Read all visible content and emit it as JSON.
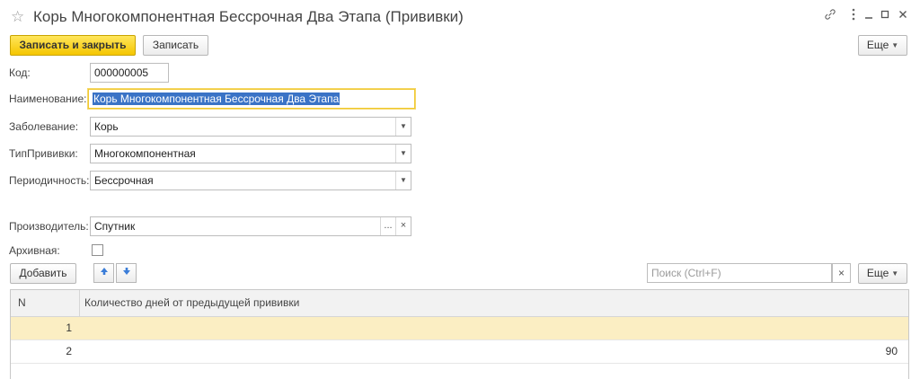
{
  "window": {
    "title": "Корь Многокомпонентная Бессрочная Два Этапа (Прививки)",
    "star_icon": "star-icon",
    "link_icon": "link-icon",
    "more_icon": "more-vertical-icon",
    "minimize_icon": "minimize-icon",
    "maximize_icon": "maximize-icon",
    "close_icon": "close-icon"
  },
  "toolbar": {
    "save_close_label": "Записать и закрыть",
    "save_label": "Записать",
    "more_label": "Еще"
  },
  "form": {
    "code_label": "Код:",
    "code_value": "000000005",
    "name_label": "Наименование:",
    "name_value": "Корь Многокомпонентная Бессрочная Два Этапа",
    "disease_label": "Заболевание:",
    "disease_value": "Корь",
    "type_label": "ТипПрививки:",
    "type_value": "Многокомпонентная",
    "period_label": "Периодичность:",
    "period_value": "Бессрочная",
    "producer_label": "Производитель:",
    "producer_value": "Спутник",
    "producer_select_glyph": "...",
    "producer_clear_glyph": "×",
    "archive_label": "Архивная:",
    "archive_checked": false
  },
  "table_toolbar": {
    "add_label": "Добавить",
    "up_icon": "arrow-up-icon",
    "down_icon": "arrow-down-icon",
    "search_placeholder": "Поиск (Ctrl+F)",
    "search_clear_glyph": "×",
    "more_label": "Еще"
  },
  "table": {
    "columns": [
      "N",
      "Количество дней от предыдущей прививки"
    ],
    "rows": [
      {
        "n": "1",
        "days": ""
      },
      {
        "n": "2",
        "days": "90"
      }
    ],
    "selected_row": 0
  },
  "colors": {
    "primary_button": "#f5c600",
    "selection_blue": "#3a73c6",
    "selected_row": "#fbeec3",
    "focus_border": "#f0c830",
    "arrow_blue": "#3b7dd8"
  }
}
